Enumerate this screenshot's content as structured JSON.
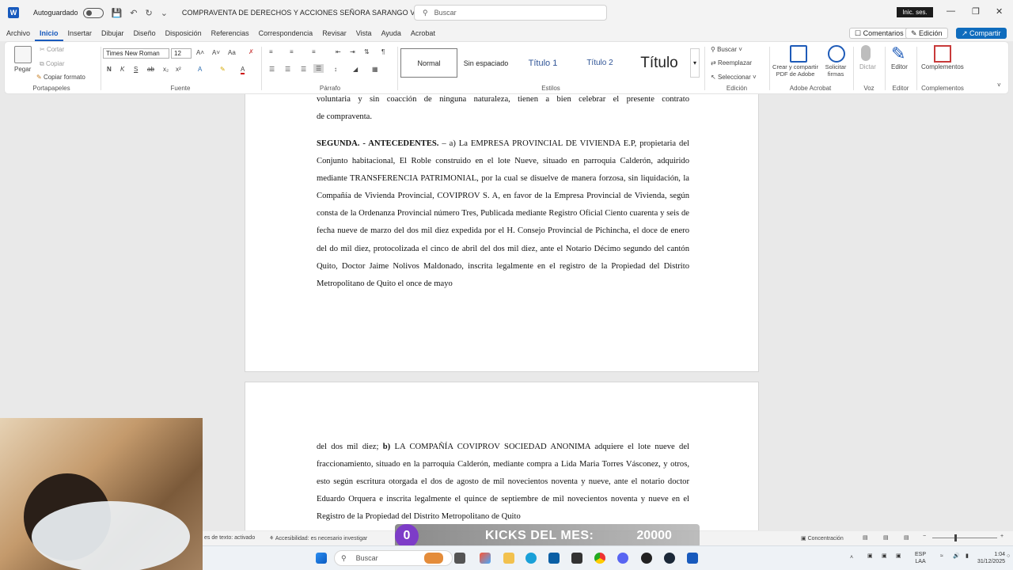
{
  "titlebar": {
    "app_icon": "word-logo",
    "autosave_label": "Autoguardado",
    "doc_title": "COMPRAVENTA DE DERECHOS Y ACCIONES SEÑORA SARANGO VILLACIS",
    "search_placeholder": "Buscar",
    "signin_label": "Inic. ses."
  },
  "tabs": [
    "Archivo",
    "Inicio",
    "Insertar",
    "Dibujar",
    "Diseño",
    "Disposición",
    "Referencias",
    "Correspondencia",
    "Revisar",
    "Vista",
    "Ayuda",
    "Acrobat"
  ],
  "right_buttons": {
    "comments": "Comentarios",
    "edit": "Edición",
    "share": "Compartir"
  },
  "ribbon": {
    "clipboard": {
      "paste": "Pegar",
      "cut": "Cortar",
      "copy": "Copiar",
      "format_painter": "Copiar formato",
      "group": "Portapapeles"
    },
    "font": {
      "family": "Times New Roman",
      "size": "12",
      "group": "Fuente"
    },
    "paragraph": {
      "group": "Párrafo"
    },
    "styles": {
      "items": [
        "Normal",
        "Sin espaciado",
        "Título 1",
        "Título 2",
        "Título"
      ],
      "group": "Estilos"
    },
    "editing": {
      "find": "Buscar",
      "replace": "Reemplazar",
      "select": "Seleccionar",
      "group": "Edición"
    },
    "acrobat": {
      "create": "Crear y compartir PDF de Adobe",
      "sign": "Solicitar firmas",
      "group": "Adobe Acrobat"
    },
    "voice": {
      "dictate": "Dictar",
      "group": "Voz"
    },
    "editor": {
      "label": "Editor",
      "group": "Editor"
    },
    "addins": {
      "label": "Complementos",
      "group": "Complementos"
    }
  },
  "document": {
    "page1": [
      "voluntaria y sin coacción de ninguna naturaleza, tienen a bien celebrar el presente contrato",
      "de compraventa.",
      "SEGUNDA. - ANTECEDENTES. – a) La EMPRESA PROVINCIAL DE VIVIENDA E.P, propietaria del Conjunto habitacional, El Roble construido en el lote Nueve, situado en parroquia Calderón, adquirido mediante TRANSFERENCIA PATRIMONIAL, por la cual se disuelve de manera forzosa, sin liquidación, la Compañía de Vivienda Provincial, COVIPROV S. A, en favor de la Empresa Provincial de Vivienda, según consta de la Ordenanza Provincial número Tres, Publicada mediante Registro Oficial Ciento cuarenta y seis de fecha nueve de marzo del dos mil diez expedida por el H. Consejo Provincial de Pichincha, el doce de enero del do mil diez, protocolizada el cinco de abril del dos mil diez, ante el Notario Décimo segundo del cantón Quito, Doctor Jaime Nolivos Maldonado, inscrita legalmente en el registro de la Propiedad del Distrito Metropolitano de Quito el once de mayo"
    ],
    "page2": "del dos mil diez; b) LA COMPAÑÍA COVIPROV SOCIEDAD ANONIMA adquiere el lote nueve del fraccionamiento, situado en la parroquia Calderón, mediante compra a Lida Maria Torres Vásconez, y otros, esto según escritura otorgada el dos de agosto de mil novecientos noventa y nueve, ante el notario doctor Eduardo Orquera e inscrita legalmente el quince de septiembre de mil novecientos noventa y nueve en el Registro de la Propiedad del Distrito Metropolitano de Quito"
  },
  "statusbar": {
    "text_pred": "es de texto: activado",
    "accessibility": "Accesibilidad: es necesario investigar",
    "focus": "Concentración"
  },
  "kicks_overlay": {
    "count": "0",
    "label": "KICKS DEL MES:",
    "goal": "20000"
  },
  "taskbar": {
    "search": "Buscar",
    "lang": "ESP",
    "region": "LAA",
    "time": "1:04",
    "date": "31/12/2025"
  }
}
